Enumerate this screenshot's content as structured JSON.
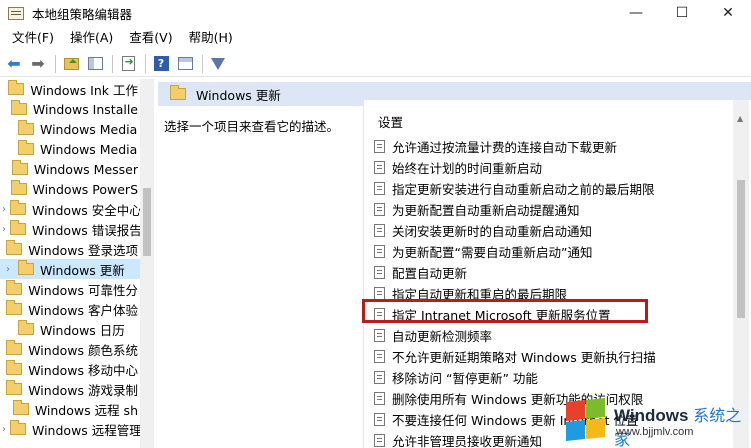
{
  "window": {
    "title": "本地组策略编辑器",
    "minimize": "—",
    "maximize": "☐",
    "close": "✕"
  },
  "menu": [
    "文件(F)",
    "操作(A)",
    "查看(V)",
    "帮助(H)"
  ],
  "toolbar_icons": [
    "back-arrow-icon",
    "forward-arrow-icon",
    "up-folder-icon",
    "show-hide-tree-icon",
    "export-list-icon",
    "help-icon",
    "view-icon",
    "filter-icon"
  ],
  "tree": {
    "selected_index": 9,
    "items": [
      {
        "label": "Windows Ink 工作",
        "expandable": false
      },
      {
        "label": "Windows Installe",
        "expandable": false
      },
      {
        "label": "Windows Media",
        "expandable": false
      },
      {
        "label": "Windows Media",
        "expandable": false
      },
      {
        "label": "Windows Messer",
        "expandable": false
      },
      {
        "label": "Windows PowerS",
        "expandable": false
      },
      {
        "label": "Windows 安全中心",
        "expandable": true
      },
      {
        "label": "Windows 错误报告",
        "expandable": true
      },
      {
        "label": "Windows 登录选项",
        "expandable": false
      },
      {
        "label": "Windows 更新",
        "expandable": true
      },
      {
        "label": "Windows 可靠性分",
        "expandable": false
      },
      {
        "label": "Windows 客户体验",
        "expandable": false
      },
      {
        "label": "Windows 日历",
        "expandable": false
      },
      {
        "label": "Windows 颜色系统",
        "expandable": false
      },
      {
        "label": "Windows 移动中心",
        "expandable": false
      },
      {
        "label": "Windows 游戏录制",
        "expandable": false
      },
      {
        "label": "Windows 远程 sh",
        "expandable": false
      },
      {
        "label": "Windows 远程管理",
        "expandable": true
      }
    ]
  },
  "right_pane": {
    "header_title": "Windows 更新",
    "description": "选择一个项目来查看它的描述。",
    "column_header": "设置",
    "highlighted_index": 8,
    "settings": [
      "允许通过按流量计费的连接自动下载更新",
      "始终在计划的时间重新启动",
      "指定更新安装进行自动重新启动之前的最后期限",
      "为更新配置自动重新启动提醒通知",
      "关闭安装更新时的自动重新启动通知",
      "为更新配置“需要自动重新启动”通知",
      "配置自动更新",
      "指定自动更新和重启的最后期限",
      "指定 Intranet Microsoft 更新服务位置",
      "自动更新检测频率",
      "不允许更新延期策略对 Windows 更新执行扫描",
      "移除访问 “暂停更新” 功能",
      "删除使用所有 Windows 更新功能的访问权限",
      "不要连接任何 Windows 更新 Internet 位置",
      "允许非管理员接收更新通知"
    ]
  },
  "watermark": {
    "brand": "Windows",
    "suffix": "系统之家",
    "url": "www.bjjmlv.com"
  },
  "colors": {
    "header_bg": "#dce6f4",
    "selection_bg": "#cce8ff",
    "highlight_border": "#b81d1d",
    "win_logo": [
      "#e8412b",
      "#7cbb2a",
      "#1f9be0",
      "#f5b816"
    ]
  }
}
